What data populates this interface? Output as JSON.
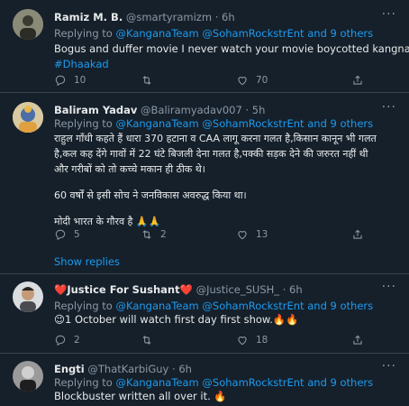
{
  "tweets": [
    {
      "name": "Ramiz M. B.",
      "handle": "@smartyramizm",
      "time": "· 6h",
      "replying_prefix": "Replying to ",
      "replying_users": "@KanganaTeam @SohamRockstrEnt",
      "replying_suffix": " and 9 others",
      "lines": [
        "Bogus and duffer movie I never watch your movie boycotted kangna"
      ],
      "hashtag": "#Dhaakad",
      "reply_count": "10",
      "retweet_count": "",
      "like_count": "70"
    },
    {
      "name": "Baliram Yadav",
      "handle": "@Baliramyadav007",
      "time": "· 5h",
      "replying_prefix": "Replying to ",
      "replying_users": "@KanganaTeam @SohamRockstrEnt",
      "replying_suffix": " and 9 others",
      "lines": [
        "राहुल गाँधी कहते हैं धारा 370 हटाना व CAA लागू करना गलत है,किसान कानून भी गलत",
        "है,कल कह देंगे गावों में 22 घंटे बिजली देना गलत है,पक्की सड़क देने की जरुरत नहीं थी",
        "और गरीबों को तो कच्चे मकान ही ठीक थे।",
        "60 वर्षों से इसी सोच ने जनविकास अवरुद्ध किया था।",
        "मोदी भारत के गौरव है 🙏🙏"
      ],
      "reply_count": "5",
      "retweet_count": "2",
      "like_count": "13"
    },
    {
      "name": "❤️Justice For Sushant❤️",
      "handle": "@Justice_SUSH_",
      "time": "· 6h",
      "replying_prefix": "Replying to ",
      "replying_users": "@KanganaTeam @SohamRockstrEnt",
      "replying_suffix": " and 9 others",
      "lines": [
        "😉1 October will watch first day first show.🔥🔥"
      ],
      "reply_count": "2",
      "retweet_count": "",
      "like_count": "18"
    },
    {
      "name": "Engti",
      "handle": "@ThatKarbiGuy",
      "time": "· 6h",
      "replying_prefix": "Replying to ",
      "replying_users": "@KanganaTeam @SohamRockstrEnt",
      "replying_suffix": " and 9 others",
      "lines": [
        "Blockbuster written all over it. 🔥"
      ]
    }
  ],
  "show_replies": "Show replies",
  "colors": {
    "background": "#15202b",
    "accent": "#1d9bf0",
    "muted": "#8b98a5",
    "border": "#38444d"
  },
  "icons": [
    "more-icon",
    "reply-icon",
    "retweet-icon",
    "like-icon",
    "share-icon"
  ]
}
